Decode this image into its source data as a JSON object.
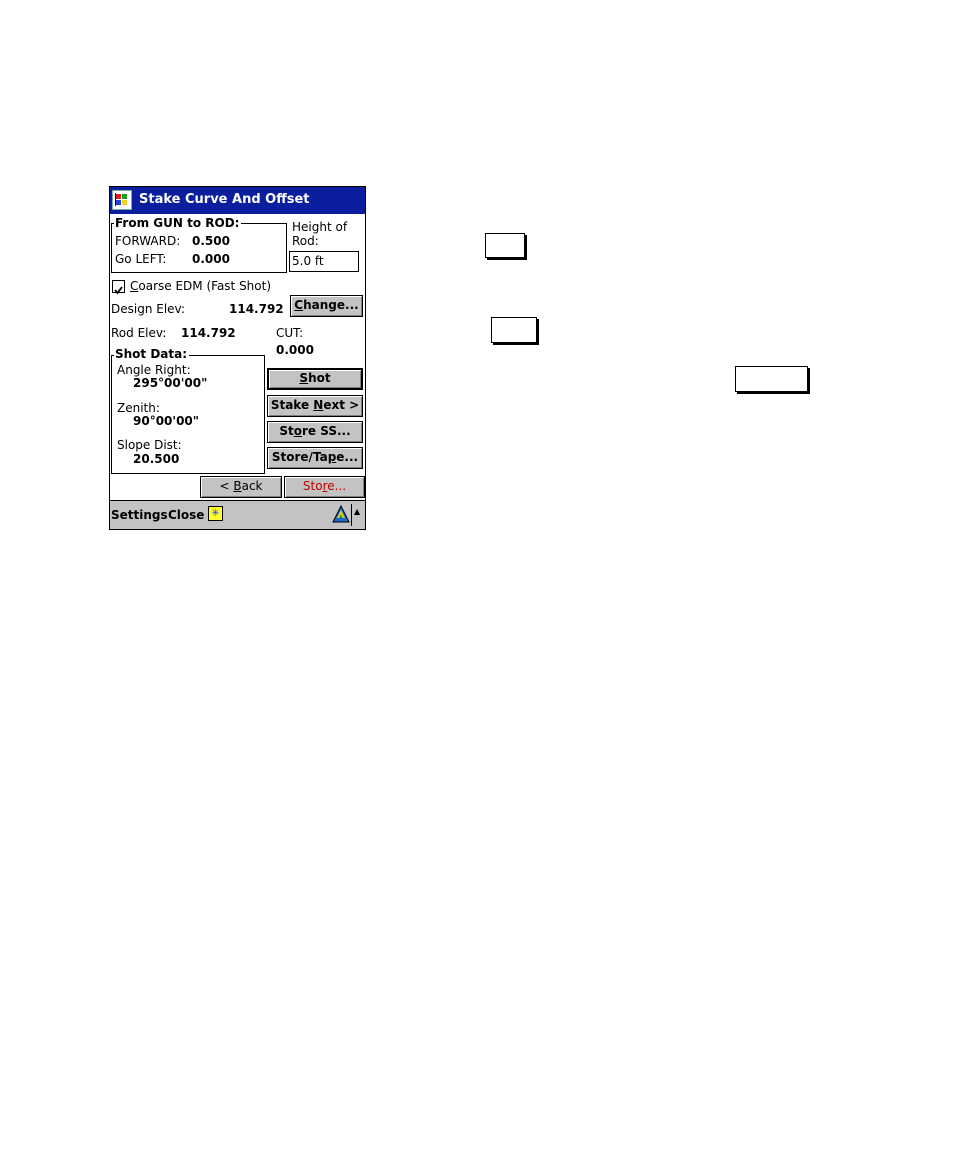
{
  "window": {
    "title": "Stake Curve And Offset",
    "app_icon": "windows-flag-icon"
  },
  "from_gun_to_rod": {
    "label": "From GUN to ROD:",
    "forward_label": "FORWARD:",
    "forward_value": "0.500",
    "go_left_label": "Go LEFT:",
    "go_left_value": "0.000"
  },
  "height_of_rod": {
    "label_line1": "Height of",
    "label_line2": "Rod:",
    "value": "5.0 ft"
  },
  "coarse_edm": {
    "label_first": "C",
    "label_rest": "oarse EDM (Fast Shot)",
    "checked": true
  },
  "design_elev": {
    "label": "Design Elev:",
    "value": "114.792",
    "change_button_first": "C",
    "change_button_rest": "hange..."
  },
  "rod_elev": {
    "label": "Rod Elev:",
    "value": "114.792"
  },
  "cut": {
    "label": "CUT:",
    "value": "0.000"
  },
  "shot_data": {
    "label": "Shot Data:",
    "angle_right_label": "Angle Right:",
    "angle_right_value": "295°00'00\"",
    "zenith_label": "Zenith:",
    "zenith_value": "90°00'00\"",
    "slope_dist_label": "Slope Dist:",
    "slope_dist_value": "20.500"
  },
  "buttons": {
    "shot_first": "S",
    "shot_rest": "hot",
    "stake_next_pre": "Stake ",
    "stake_next_u": "N",
    "stake_next_post": "ext >",
    "store_ss_pre": "St",
    "store_ss_u": "o",
    "store_ss_post": "re SS...",
    "store_tape_pre": "Store/Ta",
    "store_tape_u": "p",
    "store_tape_post": "e...",
    "back_pre": "< ",
    "back_u": "B",
    "back_post": "ack",
    "store_pre": "Sto",
    "store_u": "r",
    "store_post": "e..."
  },
  "taskbar": {
    "settings": "Settings",
    "close": "Close",
    "sun_icon": "sun-icon",
    "logo_icon": "triangle-logo-icon",
    "arrow_icon": "up-arrow-icon"
  },
  "colors": {
    "titlebar": "#0b1f9e",
    "button_face": "#c3c3c3",
    "store_text": "#c00000",
    "sun_bg": "#ffff33"
  }
}
